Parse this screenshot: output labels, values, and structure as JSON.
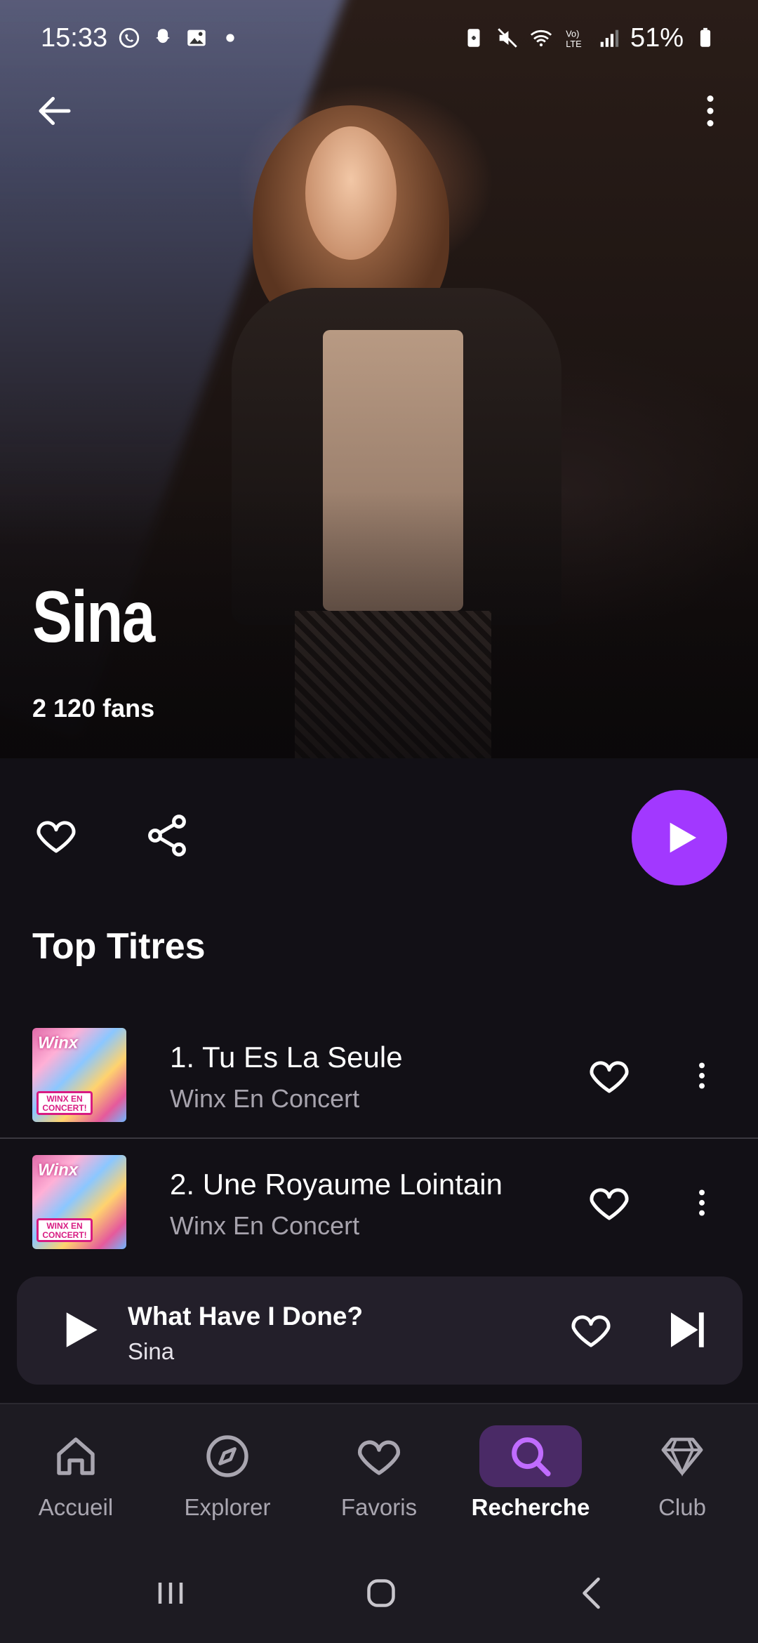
{
  "status_bar": {
    "time": "15:33",
    "battery": "51%",
    "left_icons": [
      "whatsapp-icon",
      "snapchat-icon",
      "gallery-icon",
      "dot-icon"
    ],
    "right_icons": [
      "battery-saver-icon",
      "mute-icon",
      "wifi-icon",
      "volte-icon",
      "signal-icon",
      "battery-icon"
    ]
  },
  "artist": {
    "name": "Sina",
    "fans": "2 120 fans"
  },
  "colors": {
    "accent": "#a238ff",
    "background": "#121016",
    "muted_text": "#a7a3ad"
  },
  "section": {
    "top_titles": "Top Titres"
  },
  "tracks": [
    {
      "title": "1. Tu Es La Seule",
      "album": "Winx En Concert",
      "cover_logo": "Winx",
      "cover_badge": "WINX EN CONCERT!"
    },
    {
      "title": "2. Une Royaume Lointain",
      "album": "Winx En Concert",
      "cover_logo": "Winx",
      "cover_badge": "WINX EN CONCERT!"
    }
  ],
  "mini_player": {
    "title": "What Have I Done?",
    "artist": "Sina"
  },
  "bottom_nav": {
    "items": [
      {
        "label": "Accueil",
        "icon": "home-icon"
      },
      {
        "label": "Explorer",
        "icon": "compass-icon"
      },
      {
        "label": "Favoris",
        "icon": "heart-icon"
      },
      {
        "label": "Recherche",
        "icon": "search-icon",
        "active": true
      },
      {
        "label": "Club",
        "icon": "diamond-icon"
      }
    ]
  }
}
